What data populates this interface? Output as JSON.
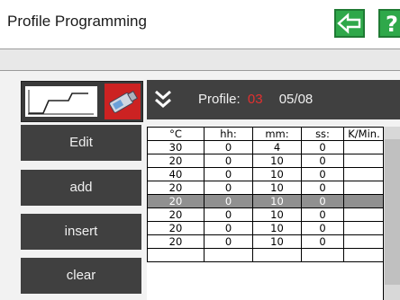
{
  "title": "Profile Programming",
  "help_label": "?",
  "profile": {
    "label": "Profile:",
    "number": "03",
    "count": "05/08"
  },
  "buttons": {
    "edit": "Edit",
    "add": "add",
    "insert": "insert",
    "clear": "clear"
  },
  "table": {
    "headers": [
      "°C",
      "hh:",
      "mm:",
      "ss:",
      "K/Min."
    ],
    "rows": [
      [
        "30",
        "0",
        "4",
        "0",
        ""
      ],
      [
        "20",
        "0",
        "10",
        "0",
        ""
      ],
      [
        "40",
        "0",
        "10",
        "0",
        ""
      ],
      [
        "20",
        "0",
        "10",
        "0",
        ""
      ],
      [
        "20",
        "0",
        "10",
        "0",
        ""
      ],
      [
        "20",
        "0",
        "10",
        "0",
        ""
      ],
      [
        "20",
        "0",
        "10",
        "0",
        ""
      ],
      [
        "20",
        "0",
        "10",
        "0",
        ""
      ],
      [
        "",
        "",
        "",
        "",
        ""
      ]
    ],
    "selected_row": 4
  },
  "colors": {
    "accent_green": "#2fa84a",
    "profile_number": "#e23030",
    "usb_bg": "#cc2222"
  },
  "icons": [
    "temperature-profile-icon",
    "usb-stick-icon",
    "chevron-down-icon",
    "back-arrow-icon",
    "help-icon"
  ]
}
